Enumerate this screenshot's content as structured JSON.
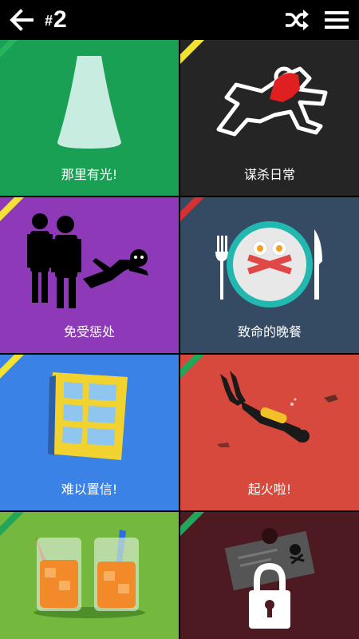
{
  "header": {
    "level_prefix": "#",
    "level_number": "2",
    "back_icon": "arrow-left-icon",
    "shuffle_icon": "shuffle-icon",
    "menu_icon": "hamburger-menu-icon"
  },
  "colors": {
    "header_bg": "#000000",
    "tile_green": "#1aa055",
    "tile_dark": "#252525",
    "tile_purple": "#8e3ab8",
    "tile_navy": "#354a63",
    "tile_blue": "#3a82e6",
    "tile_red": "#d8493d",
    "tile_lime": "#74b83e",
    "tile_maroon": "#4e1a22",
    "stripe_yellow": "#f2e234",
    "stripe_green": "#22a65a",
    "stripe_red": "#d83030"
  },
  "levels": [
    {
      "title": "那里有光!",
      "icon": "spotlight-cone-icon"
    },
    {
      "title": "谋杀日常",
      "icon": "chalk-outline-icon"
    },
    {
      "title": "免受惩处",
      "icon": "escaping-figure-icon"
    },
    {
      "title": "致命的晚餐",
      "icon": "skull-plate-icon"
    },
    {
      "title": "难以置信!",
      "icon": "window-icon"
    },
    {
      "title": "起火啦!",
      "icon": "scuba-diver-icon"
    },
    {
      "title": "",
      "icon": "juice-glasses-icon"
    },
    {
      "title": "",
      "icon": "padlock-icon",
      "locked": true
    }
  ]
}
